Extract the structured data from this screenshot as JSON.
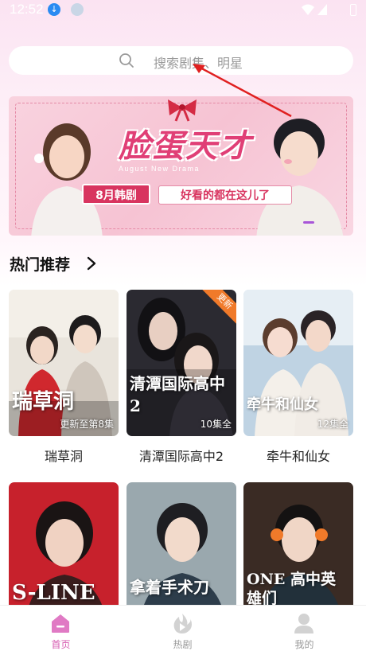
{
  "status_bar": {
    "time": "12:52",
    "download_icon": "download-icon",
    "wifi_icon": "wifi-icon",
    "signal_icon": "signal-icon",
    "battery_icon": "battery-icon"
  },
  "search": {
    "placeholder": "搜索剧集、明星",
    "icon": "search-icon"
  },
  "banner": {
    "title": "脸蛋天才",
    "subtitle": "August New Drama",
    "tag_left": "8月韩剧",
    "tag_right": "好看的都在这儿了"
  },
  "section": {
    "title": "热门推荐"
  },
  "cards": [
    {
      "name": "瑞草洞",
      "poster_title": "瑞草洞",
      "episode": "更新至第8集"
    },
    {
      "name": "清潭国际高中2",
      "poster_title": "清潭国际高中2",
      "episode": "10集全",
      "badge": "更新"
    },
    {
      "name": "牵牛和仙女",
      "poster_title": "牵牛和仙女",
      "episode": "12集全"
    },
    {
      "poster_title": "S-LINE"
    },
    {
      "poster_title": "拿着手术刀"
    },
    {
      "poster_title": "ONE 高中英雄们"
    }
  ],
  "nav": {
    "items": [
      {
        "label": "首页",
        "icon": "home-icon",
        "active": true
      },
      {
        "label": "热剧",
        "icon": "fire-icon",
        "active": false
      },
      {
        "label": "我的",
        "icon": "profile-icon",
        "active": false
      }
    ]
  },
  "colors": {
    "accent": "#d65ab0",
    "banner_pink": "#e03f76",
    "new_badge": "#f07a2a"
  }
}
